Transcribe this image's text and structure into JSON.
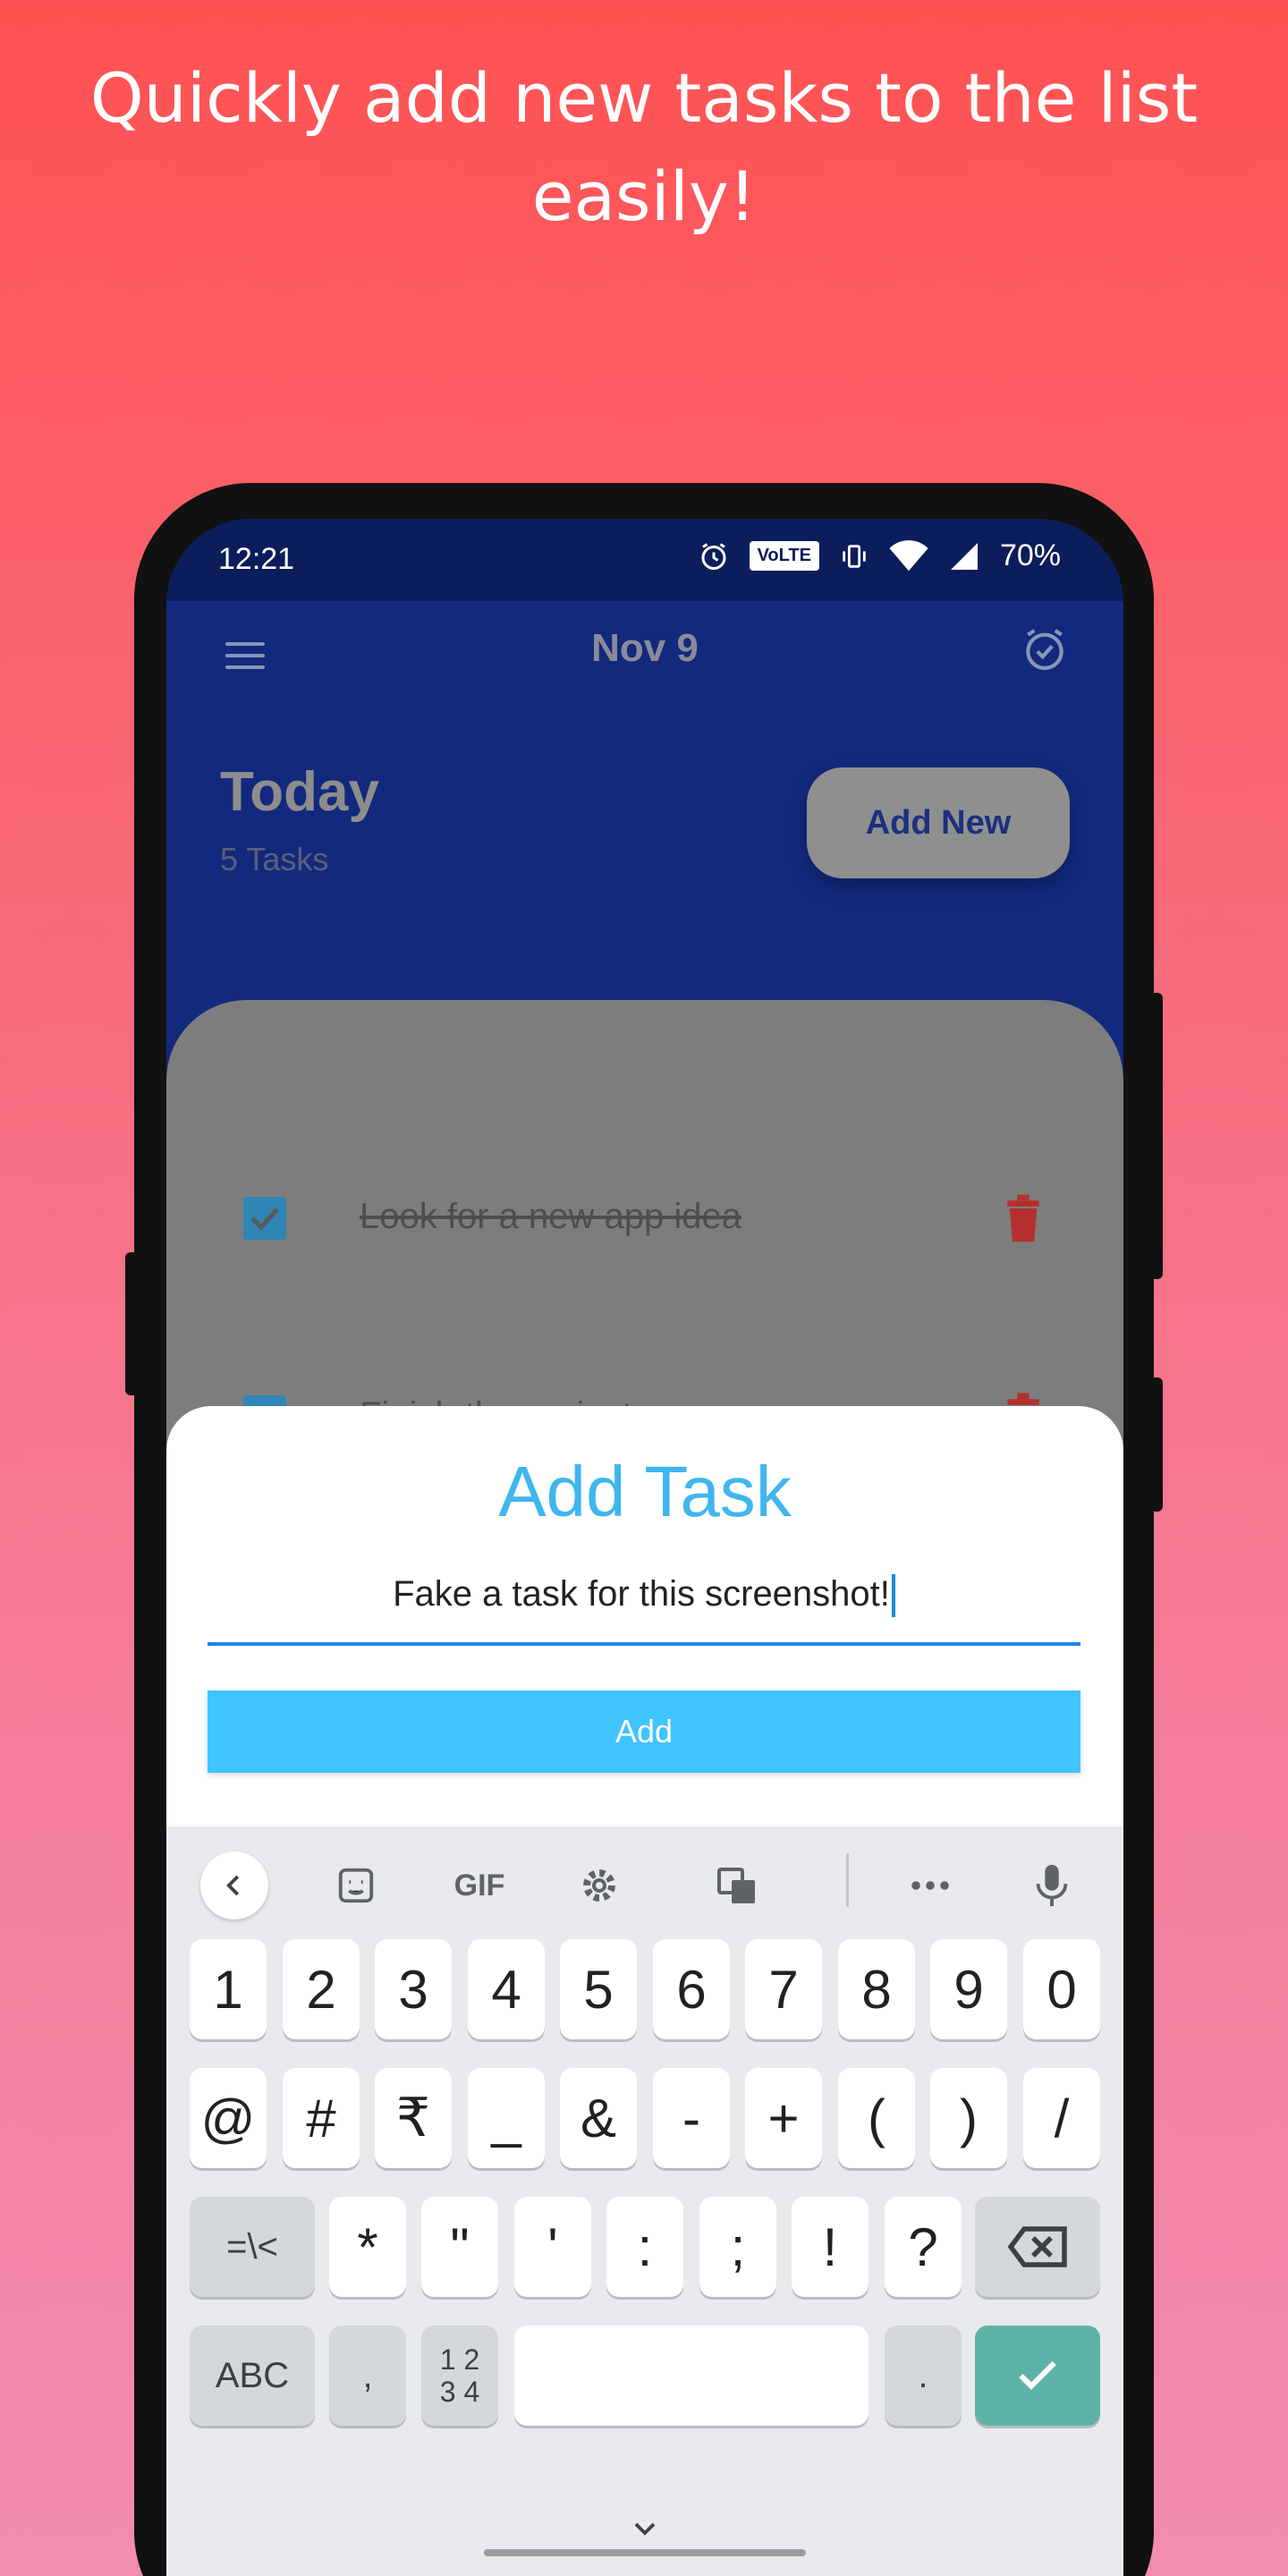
{
  "headline": "Quickly add new tasks to the list easily!",
  "status": {
    "time": "12:21",
    "volte": "VoLTE",
    "battery": "70%"
  },
  "appbar": {
    "title": "Nov 9",
    "menu_icon": "hamburger-menu-icon",
    "alarm_icon": "alarm-check-icon"
  },
  "header": {
    "today": "Today",
    "count": "5 Tasks",
    "add_new": "Add New"
  },
  "tasks": [
    {
      "label": "Look for a new app idea",
      "done": true
    },
    {
      "label": "Finish the project",
      "done": true
    }
  ],
  "dialog": {
    "title": "Add Task",
    "input_value": "Fake a task for this screenshot!",
    "button": "Add"
  },
  "keyboard": {
    "toolbar": {
      "gif": "GIF"
    },
    "row1": [
      "1",
      "2",
      "3",
      "4",
      "5",
      "6",
      "7",
      "8",
      "9",
      "0"
    ],
    "row2": [
      "@",
      "#",
      "₹",
      "_",
      "&",
      "-",
      "+",
      "(",
      ")",
      "/"
    ],
    "row3": [
      "=\\<",
      "*",
      "\"",
      "'",
      ":",
      ";",
      "!",
      "?"
    ],
    "row4": {
      "abc": "ABC",
      "comma": ",",
      "num_top": "1 2",
      "num_bottom": "3 4",
      "period": "."
    }
  },
  "colors": {
    "accent": "#40c4ff",
    "title": "#3fb6ee",
    "enter": "#5db3a8",
    "trash": "#b3302e"
  }
}
